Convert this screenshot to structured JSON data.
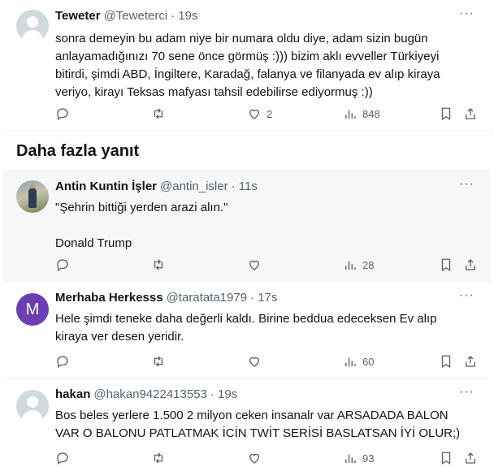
{
  "section_title": "Daha fazla yanıt",
  "more_label": "···",
  "tweets": [
    {
      "name": "Teweter",
      "handle": "@Teweterci",
      "time": "· 19s",
      "avatar": "default-avatar",
      "text": "sonra demeyin bu adam niye bir numara oldu diye, adam sizin bugün\nanlayamadığınızı 70 sene önce görmüş :))) bizim aklı evveller Türkiyeyi\nbitirdi, şimdi ABD, İngiltere, Karadağ, falanya ve filanyada ev alıp kiraya\nveriyo, kirayı Teksas mafyası tahsil edebilirse ediyormuş :))",
      "reply_count": "",
      "retweet_count": "",
      "like_count": "2",
      "view_count": "848"
    },
    {
      "name": "Antin Kuntin İşler",
      "handle": "@antin_isler",
      "time": "· 11s",
      "avatar": "photo-avatar",
      "text": "\"Şehrin bittiği yerden arazi alın.\"\n\nDonald Trump",
      "reply_count": "",
      "retweet_count": "",
      "like_count": "",
      "view_count": "28"
    },
    {
      "name": "Merhaba Herkesss",
      "handle": "@taratata1979",
      "time": "· 17s",
      "avatar": "letter-avatar",
      "avatar_letter": "M",
      "text": "Hele şimdi teneke daha değerli kaldı. Birine beddua edeceksen Ev alıp\nkiraya ver desen yeridir.",
      "reply_count": "",
      "retweet_count": "",
      "like_count": "",
      "view_count": "60"
    },
    {
      "name": "hakan",
      "handle": "@hakan9422413553",
      "time": "· 19s",
      "avatar": "default-avatar",
      "text": "Bos beles yerlere 1.500 2 milyon ceken insanalr var ARSADADA BALON\nVAR O BALONU PATLATMAK İCİN TWİT SERİSİ BASLATSAN İYİ OLUR;)",
      "reply_count": "",
      "retweet_count": "",
      "like_count": "",
      "view_count": "93"
    }
  ],
  "colors": {
    "text": "#0f1419",
    "muted": "#536471",
    "letter_avatar": "#6b3fb3",
    "highlight_bg": "#f7f7f7"
  }
}
